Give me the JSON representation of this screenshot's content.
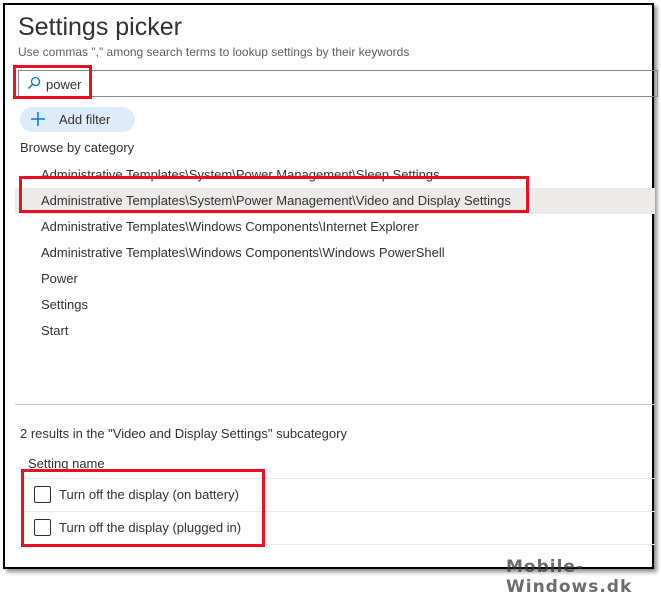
{
  "header": {
    "title": "Settings picker",
    "subtitle": "Use commas \",\" among search terms to lookup settings by their keywords"
  },
  "search": {
    "value": "power",
    "icon": "search-icon"
  },
  "add_filter": {
    "label": "Add filter",
    "icon": "plus-icon"
  },
  "browse": {
    "label": "Browse by category",
    "items": [
      {
        "label": "Administrative Templates\\System\\Power Management\\Sleep Settings",
        "selected": false
      },
      {
        "label": "Administrative Templates\\System\\Power Management\\Video and Display Settings",
        "selected": true
      },
      {
        "label": "Administrative Templates\\Windows Components\\Internet Explorer",
        "selected": false
      },
      {
        "label": "Administrative Templates\\Windows Components\\Windows PowerShell",
        "selected": false
      },
      {
        "label": "Power",
        "selected": false
      },
      {
        "label": "Settings",
        "selected": false
      },
      {
        "label": "Start",
        "selected": false
      }
    ]
  },
  "results": {
    "summary": "2 results in the \"Video and Display Settings\" subcategory",
    "column_header": "Setting name",
    "rows": [
      {
        "label": "Turn off the display (on battery)",
        "checked": false
      },
      {
        "label": "Turn off the display (plugged in)",
        "checked": false
      }
    ]
  },
  "watermark": "Mobile-Windows.dk",
  "colors": {
    "highlight": "#e81123",
    "accent": "#0078d4",
    "add_filter_bg": "#deecf9",
    "selected_bg": "#edebe9"
  }
}
